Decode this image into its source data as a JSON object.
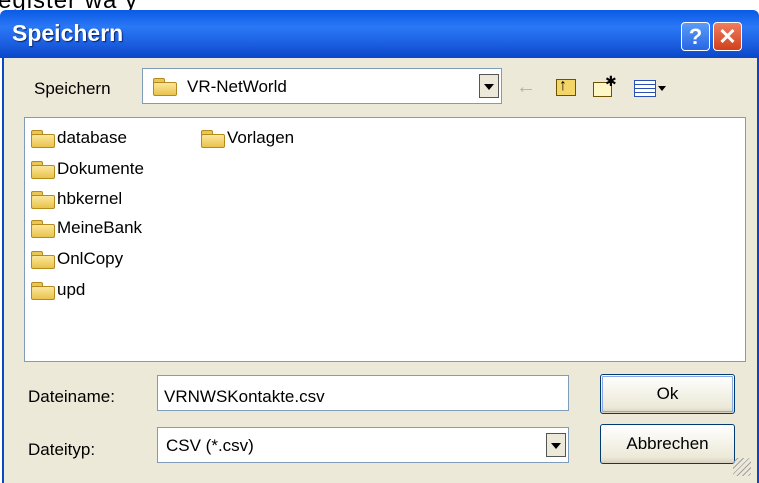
{
  "top_crop_text": "egister wä     y",
  "window": {
    "title": "Speichern"
  },
  "titlebar": {
    "help_glyph": "?",
    "close_glyph": "✕"
  },
  "location": {
    "label": "Speichern",
    "selected": "VR-NetWorld"
  },
  "toolbar": {
    "icons": [
      "back-arrow-icon",
      "up-folder-icon",
      "new-folder-icon",
      "view-menu-icon"
    ]
  },
  "file_list": {
    "items": [
      {
        "name": "database"
      },
      {
        "name": "Dokumente"
      },
      {
        "name": "hbkernel"
      },
      {
        "name": "MeineBank"
      },
      {
        "name": "OnlCopy"
      },
      {
        "name": "upd"
      },
      {
        "name": "Vorlagen"
      }
    ]
  },
  "filename": {
    "label": "Dateiname:",
    "value": "VRNWSKontakte.csv"
  },
  "filetype": {
    "label": "Dateityp:",
    "selected": "CSV (*.csv)"
  },
  "buttons": {
    "ok": "Ok",
    "cancel": "Abbrechen"
  },
  "colors": {
    "titlebar": "#0a5ae6",
    "dialog_bg": "#ece9d8",
    "folder": "#e9c24c",
    "close": "#d1401b"
  }
}
